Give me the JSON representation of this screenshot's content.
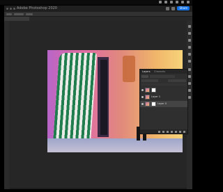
{
  "window": {
    "title": "Adobe Photoshop 2020"
  },
  "toolbar": {
    "share_label": "Share"
  },
  "document": {
    "tab_label": ""
  },
  "layers_panel": {
    "tabs": [
      {
        "label": "Layers",
        "active": true
      },
      {
        "label": "Channels",
        "active": false
      }
    ],
    "kind_label": "Kind",
    "blend_mode": "",
    "opacity_label": "",
    "layers": [
      {
        "name": "",
        "has_mask": true,
        "selected": false
      },
      {
        "name": "Layer 1",
        "has_mask": false,
        "selected": false
      },
      {
        "name": "Layer 0",
        "has_mask": true,
        "selected": true
      }
    ]
  },
  "colors": {
    "accent": "#1473e6",
    "panel_bg": "#2f2f2f",
    "canvas_bg": "#262626"
  }
}
